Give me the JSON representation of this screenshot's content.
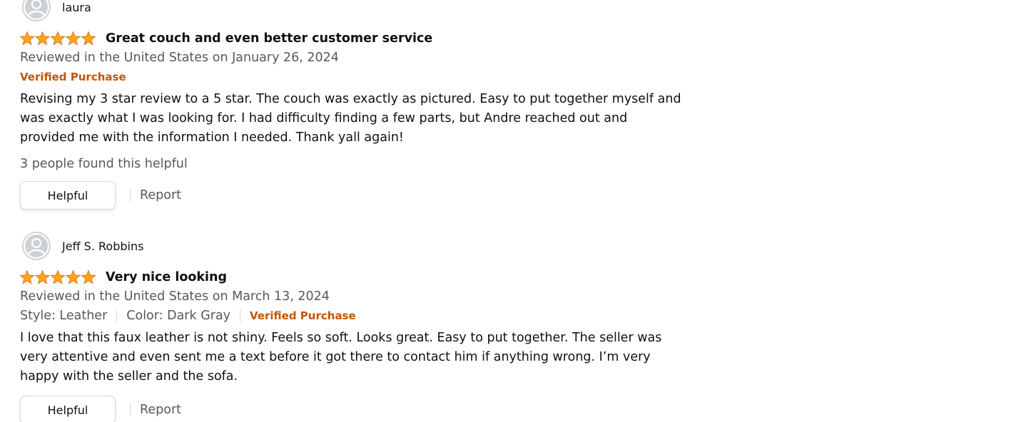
{
  "colors": {
    "star": "#ffa41c",
    "star_stroke": "#de7921",
    "verified": "#c45500",
    "secondary_text": "#565959",
    "avatar_bg": "#cdd0d4"
  },
  "reviews": [
    {
      "reviewer_name": "laura",
      "avatar_icon": "user-avatar-icon",
      "rating": 5,
      "rating_max": 5,
      "title": "Great couch and even better customer service",
      "date": "Reviewed in the United States on January 26, 2024",
      "verified_label": "Verified Purchase",
      "body": "Revising my 3 star review to a 5 star. The couch was exactly as pictured. Easy to put together myself and was exactly what I was looking for. I had difficulty finding a few parts, but Andre reached out and provided me with the information I needed. Thank yall again!",
      "helpful_count_text": "3 people found this helpful",
      "helpful_button": "Helpful",
      "report_link": "Report"
    },
    {
      "reviewer_name": "Jeff S. Robbins",
      "avatar_icon": "user-avatar-icon",
      "rating": 5,
      "rating_max": 5,
      "title": "Very nice looking",
      "date": "Reviewed in the United States on March 13, 2024",
      "style": "Style: Leather",
      "color": "Color: Dark Gray",
      "verified_label": "Verified Purchase",
      "body": "I love that this faux leather is not shiny. Feels so soft. Looks great. Easy to put together. The seller was very attentive and even sent me a text before it got there to contact him if anything wrong. I’m very happy with the seller and the sofa.",
      "helpful_button": "Helpful",
      "report_link": "Report"
    }
  ]
}
